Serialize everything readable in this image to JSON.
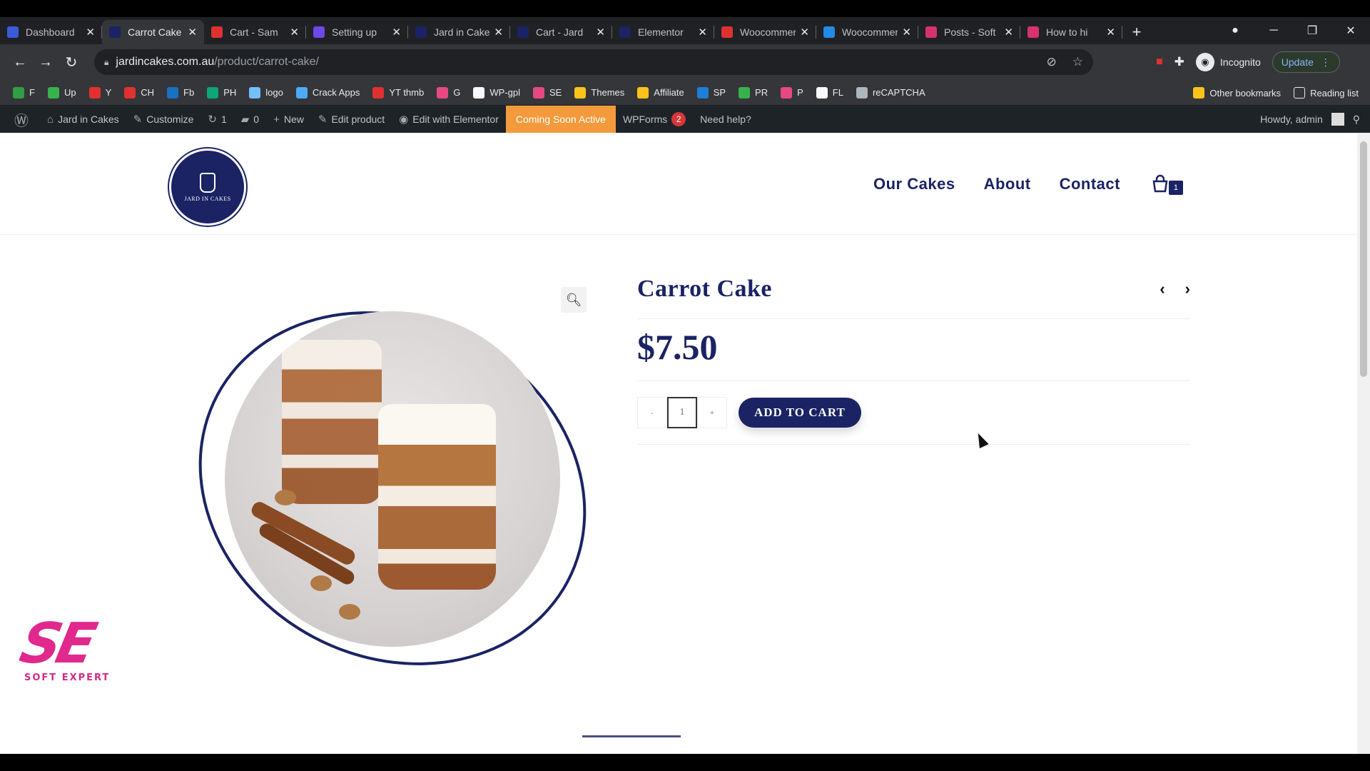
{
  "browser": {
    "tabs": [
      {
        "title": "Dashboard",
        "color": "#3b5bdb",
        "active": false
      },
      {
        "title": "Carrot Cake",
        "color": "#1b2365",
        "active": true
      },
      {
        "title": "Cart - Sam",
        "color": "#e03131",
        "active": false
      },
      {
        "title": "Setting up",
        "color": "#7048e8",
        "active": false
      },
      {
        "title": "Jard in Cake",
        "color": "#1b2365",
        "active": false
      },
      {
        "title": "Cart - Jard",
        "color": "#1b2365",
        "active": false
      },
      {
        "title": "Elementor",
        "color": "#1b2365",
        "active": false
      },
      {
        "title": "Woocommerce",
        "color": "#e03131",
        "active": false
      },
      {
        "title": "Woocommerce",
        "color": "#228be6",
        "active": false
      },
      {
        "title": "Posts - Soft",
        "color": "#d6336c",
        "active": false
      },
      {
        "title": "How to hi",
        "color": "#d6336c",
        "active": false
      }
    ],
    "url_host": "jardincakes.com.au",
    "url_path": "/product/carrot-cake/",
    "incognito_label": "Incognito",
    "update_label": "Update",
    "bookmarks": [
      {
        "label": "F",
        "color": "#2f9e44"
      },
      {
        "label": "Up",
        "color": "#37b24d"
      },
      {
        "label": "Y",
        "color": "#e03131"
      },
      {
        "label": "CH",
        "color": "#e03131"
      },
      {
        "label": "Fb",
        "color": "#1971c2"
      },
      {
        "label": "PH",
        "color": "#0ca678"
      },
      {
        "label": "logo",
        "color": "#74c0fc"
      },
      {
        "label": "Crack Apps",
        "color": "#4dabf7"
      },
      {
        "label": "YT thmb",
        "color": "#e03131"
      },
      {
        "label": "G",
        "color": "#e64980"
      },
      {
        "label": "WP-gpl",
        "color": "#f8f9fa"
      },
      {
        "label": "SE",
        "color": "#e64980"
      },
      {
        "label": "Themes",
        "color": "#fcc419"
      },
      {
        "label": "Affiliate",
        "color": "#fcc419"
      },
      {
        "label": "SP",
        "color": "#1c7ed6"
      },
      {
        "label": "PR",
        "color": "#37b24d"
      },
      {
        "label": "P",
        "color": "#e64980"
      },
      {
        "label": "FL",
        "color": "#f8f9fa"
      },
      {
        "label": "reCAPTCHA",
        "color": "#adb5bd"
      }
    ],
    "other_bookmarks": "Other bookmarks",
    "reading_list": "Reading list"
  },
  "adminbar": {
    "site_name": "Jard in Cakes",
    "customize": "Customize",
    "updates_count": "1",
    "comments_count": "0",
    "new_label": "New",
    "edit_product": "Edit product",
    "edit_elementor": "Edit with Elementor",
    "coming_soon": "Coming Soon Active",
    "wpforms": "WPForms",
    "wpforms_badge": "2",
    "need_help": "Need help?",
    "howdy": "Howdy, admin"
  },
  "site": {
    "nav": [
      "Our Cakes",
      "About",
      "Contact"
    ],
    "cart_count": "1"
  },
  "product": {
    "title": "Carrot Cake",
    "price": "$7.50",
    "qty_minus": "-",
    "qty_value": "1",
    "qty_plus": "+",
    "add_to_cart": "ADD TO CART"
  },
  "watermark": {
    "mark": "SE",
    "text": "SOFT EXPERT"
  },
  "colors": {
    "brand": "#1b2365",
    "coming_soon_bg": "#f29a3c"
  }
}
